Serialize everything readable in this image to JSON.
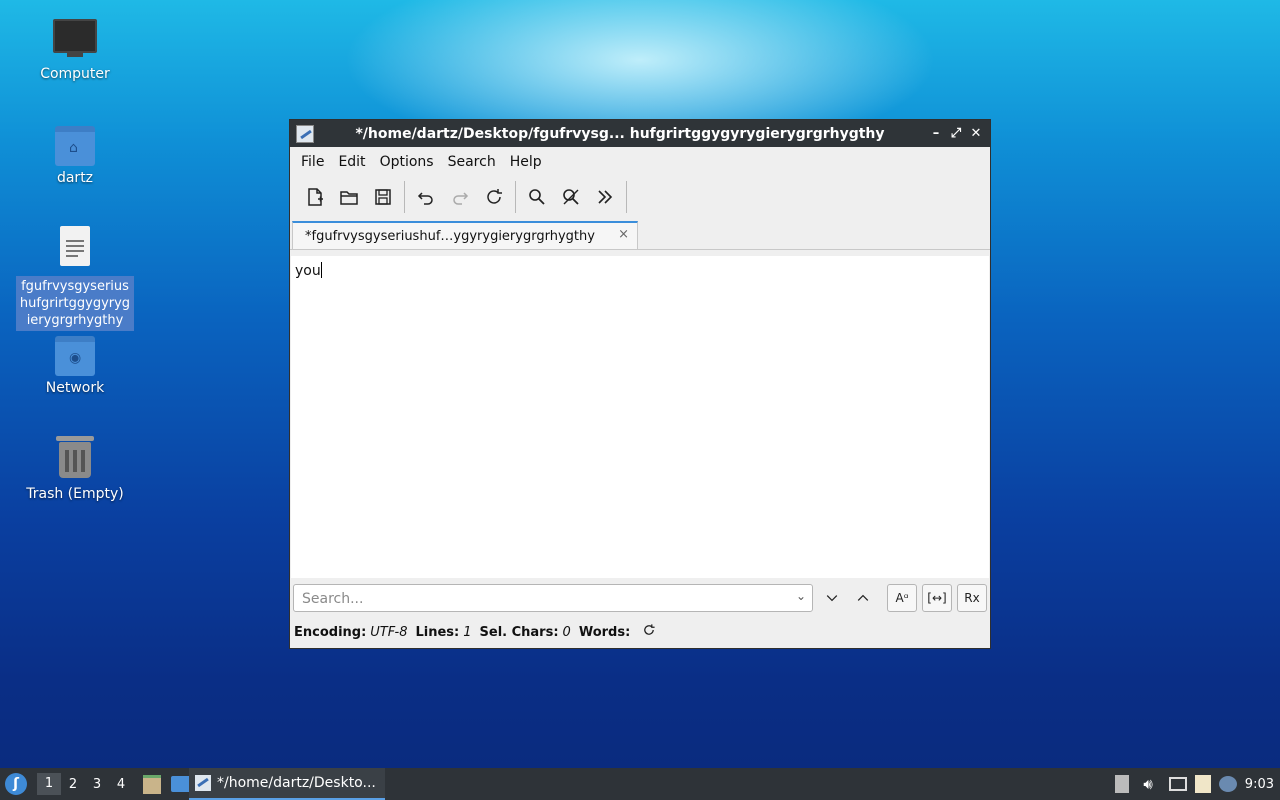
{
  "desktop": {
    "icons": [
      {
        "label": "Computer"
      },
      {
        "label": "dartz"
      },
      {
        "label": "fgufrvysgyseriushufgrirtggygyrygierygrgrhygthy"
      },
      {
        "label": "Network"
      },
      {
        "label": "Trash (Empty)"
      }
    ]
  },
  "window": {
    "title": "*/home/dartz/Desktop/fgufrvysg...  hufgrirtggygyrygierygrgrhygthy",
    "controls": {
      "minimize": "–",
      "maximize": "⤢",
      "close": "✕"
    },
    "menu": [
      {
        "label": "File"
      },
      {
        "label": "Edit"
      },
      {
        "label": "Options"
      },
      {
        "label": "Search"
      },
      {
        "label": "Help"
      }
    ],
    "tab": {
      "label": "*fgufrvysgyseriushuf…ygyrygierygrgrhygthy",
      "close": "×"
    },
    "editor": {
      "content": "you"
    },
    "search": {
      "placeholder": "Search...",
      "match_case": "Aᵅ",
      "whole_word": "[↔]",
      "regex": "Rx"
    },
    "status": {
      "encoding_label": "Encoding:",
      "encoding_value": "UTF-8",
      "lines_label": "Lines:",
      "lines_value": "1",
      "sel_label": "Sel. Chars:",
      "sel_value": "0",
      "words_label": "Words:"
    }
  },
  "taskbar": {
    "workspaces": [
      "1",
      "2",
      "3",
      "4"
    ],
    "active_workspace": "1",
    "task_label": "*/home/dartz/Deskto...",
    "clock": "9:03"
  },
  "colors": {
    "accent": "#3b8edb",
    "titlebar": "#2f3438",
    "taskbar": "#2e3338"
  }
}
